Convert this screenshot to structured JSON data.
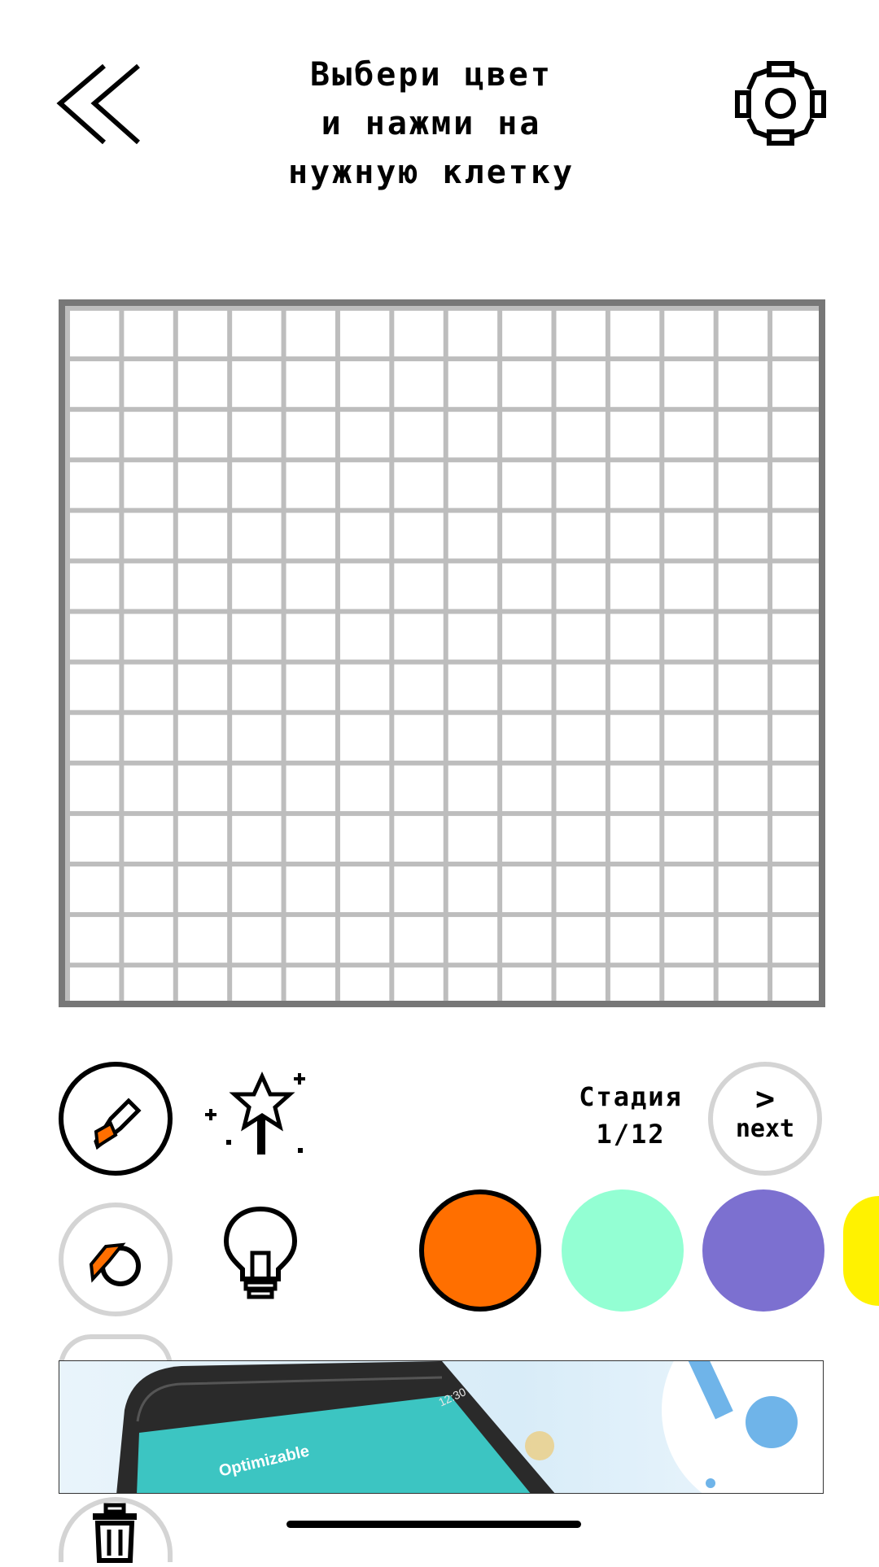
{
  "header": {
    "back_icon": "double-chevron-left-icon",
    "settings_icon": "gear-icon",
    "instruction_lines": [
      "Выбери цвет",
      "и нажми на",
      "нужную клетку"
    ]
  },
  "grid": {
    "columns": 14,
    "rows": 14
  },
  "tools": {
    "pencil_icon": "pencil-icon",
    "magic_icon": "magic-wand-icon",
    "fill_icon": "paint-bucket-icon",
    "hint_icon": "lightbulb-icon",
    "trash_icon": "trash-icon"
  },
  "stage": {
    "label": "Стадия",
    "progress": "1/12"
  },
  "next_button": {
    "label": "next"
  },
  "palette": [
    {
      "name": "orange",
      "color": "#FF6F00",
      "selected": true
    },
    {
      "name": "mint",
      "color": "#93FFD3",
      "selected": false
    },
    {
      "name": "purple",
      "color": "#7C70D0",
      "selected": false
    },
    {
      "name": "yellow",
      "color": "#FFF200",
      "selected": false
    }
  ],
  "ad": {
    "app_title": "Optimizable",
    "status_time": "12:30"
  }
}
